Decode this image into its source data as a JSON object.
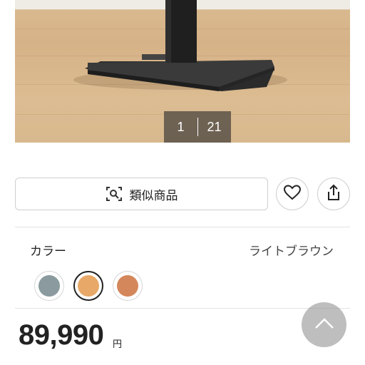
{
  "gallery": {
    "current_index": "1",
    "total_count": "21",
    "image_alt": "product-table-base"
  },
  "actions": {
    "similar_label": "類似商品",
    "similar_icon": "image-search-icon",
    "favorite_icon": "heart-icon",
    "share_icon": "share-icon"
  },
  "color": {
    "label": "カラー",
    "selected_name": "ライトブラウン",
    "swatches": [
      {
        "name": "gray",
        "hex": "#8a9a9e",
        "selected": false
      },
      {
        "name": "light-brown",
        "hex": "#e8a868",
        "selected": true
      },
      {
        "name": "brown",
        "hex": "#d4875a",
        "selected": false
      }
    ]
  },
  "price": {
    "amount": "89,990",
    "currency": "円"
  },
  "scroll_top_icon": "chevron-up-icon"
}
